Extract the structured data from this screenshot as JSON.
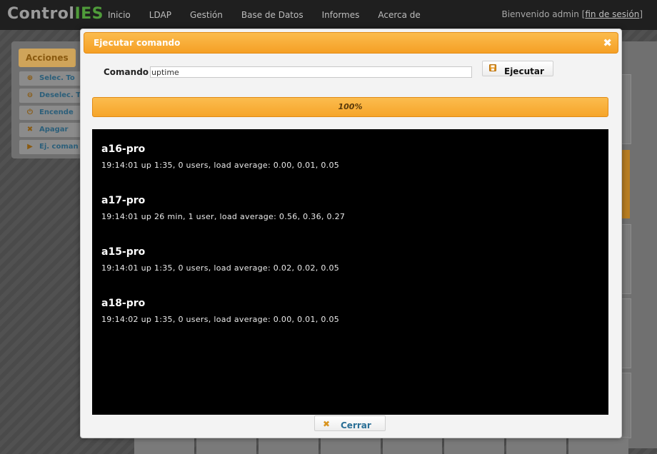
{
  "app": {
    "logo_part1": "Control",
    "logo_part2": "IES",
    "nav": [
      "Inicio",
      "LDAP",
      "Gestión",
      "Base de Datos",
      "Informes",
      "Acerca de"
    ],
    "welcome_text": "Bienvenido admin [",
    "logout_link": "fin de sesión",
    "welcome_close": "]"
  },
  "sidebar": {
    "tab": "Acciones",
    "items": [
      {
        "label": "Selec. To",
        "icon": "plus-circle-icon"
      },
      {
        "label": "Deselec. T",
        "icon": "minus-circle-icon"
      },
      {
        "label": "Encende",
        "icon": "power-icon"
      },
      {
        "label": "Apagar",
        "icon": "x-icon"
      },
      {
        "label": "Ej. coman",
        "icon": "play-icon"
      }
    ]
  },
  "modal": {
    "title": "Ejecutar comando",
    "command_label": "Comando",
    "command_value": "uptime",
    "run_label": "Ejecutar",
    "progress_percent": 100,
    "progress_text": "100%",
    "close_label": "Cerrar"
  },
  "results": [
    {
      "host": "a16-pro",
      "output": "19:14:01 up 1:35, 0 users, load average: 0.00, 0.01, 0.05"
    },
    {
      "host": "a17-pro",
      "output": "19:14:01 up 26 min, 1 user, load average: 0.56, 0.36, 0.27"
    },
    {
      "host": "a15-pro",
      "output": "19:14:01 up 1:35, 0 users, load average: 0.02, 0.02, 0.05"
    },
    {
      "host": "a18-pro",
      "output": "19:14:02 up 1:35, 0 users, load average: 0.00, 0.01, 0.05"
    }
  ],
  "colors": {
    "accent": "#f5a025",
    "console_bg": "#000000",
    "link": "#2a6f96"
  }
}
